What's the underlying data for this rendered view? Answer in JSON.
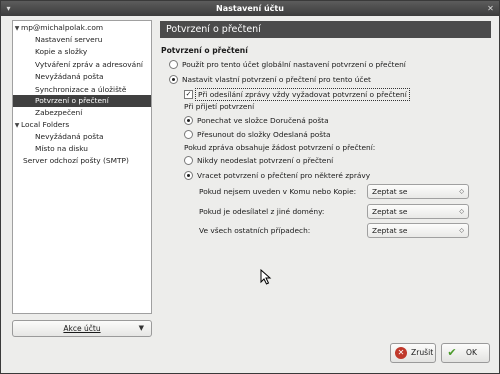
{
  "window": {
    "title": "Nastavení účtu"
  },
  "sidebar": {
    "items": [
      {
        "label": "mp@michalpolak.com",
        "expanded": true
      },
      {
        "label": "Nastavení serveru"
      },
      {
        "label": "Kopie a složky"
      },
      {
        "label": "Vytváření zpráv a adresování"
      },
      {
        "label": "Nevyžádaná pošta"
      },
      {
        "label": "Synchronizace a úložiště"
      },
      {
        "label": "Potvrzení o přečtení",
        "selected": true
      },
      {
        "label": "Zabezpečení"
      },
      {
        "label": "Local Folders",
        "expanded": true
      },
      {
        "label": "Nevyžádaná pošta"
      },
      {
        "label": "Místo na disku"
      },
      {
        "label": "Server odchozí pošty (SMTP)"
      }
    ],
    "account_actions_label": "Akce účtu"
  },
  "panel": {
    "header": "Potvrzení o přečtení",
    "section_title": "Potvrzení o přečtení",
    "use_global_label": "Použít pro tento účet globální nastavení potvrzení o přečtení",
    "use_custom_label": "Nastavit vlastní potvrzení o přečtení pro tento účet",
    "always_request_label": "Při odesílání zprávy vždy vyžadovat potvrzení o přečtení",
    "always_request_checked": true,
    "on_receipt_heading": "Při přijetí potvrzení",
    "keep_in_inbox_label": "Ponechat ve složce Doručená pošta",
    "move_to_sent_label": "Přesunout do složky Odeslaná pošta",
    "on_request_heading": "Pokud zpráva obsahuje žádost potvrzení o přečtení:",
    "never_send_label": "Nikdy neodeslat potvrzení o přečtení",
    "allow_some_label": "Vracet potvrzení o přečtení pro některé zprávy",
    "rules": [
      {
        "label": "Pokud nejsem uveden v Komu nebo Kopie:",
        "value": "Zeptat se"
      },
      {
        "label": "Pokud je odesílatel z jiné domény:",
        "value": "Zeptat se"
      },
      {
        "label": "Ve všech ostatních případech:",
        "value": "Zeptat se"
      }
    ]
  },
  "footer": {
    "cancel_label": "Zrušit",
    "ok_label": "OK"
  }
}
